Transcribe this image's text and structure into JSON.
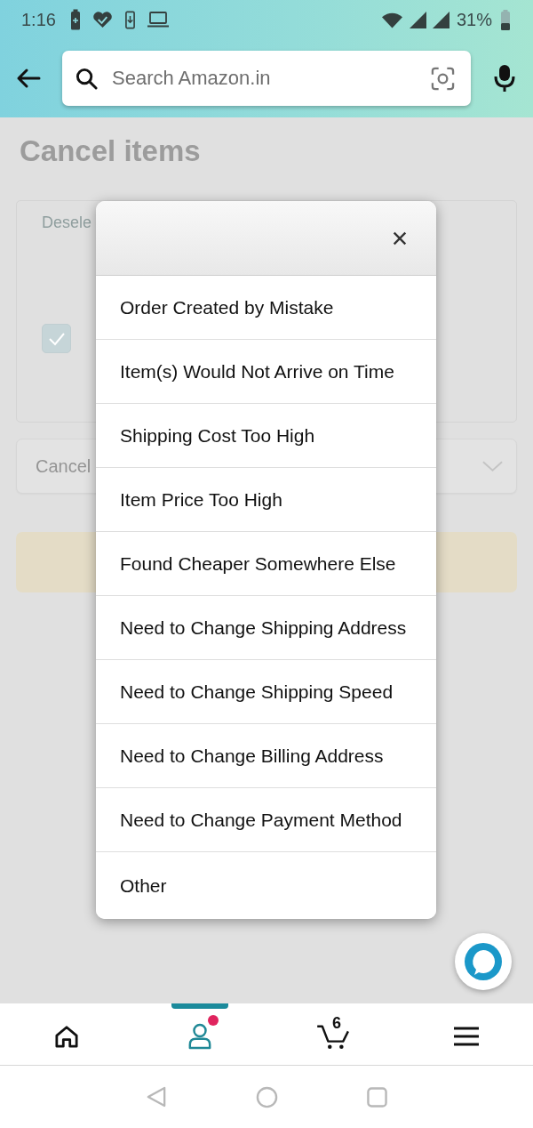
{
  "status_bar": {
    "time": "1:16",
    "battery_percent": "31%"
  },
  "header": {
    "search": {
      "placeholder": "Search Amazon.in"
    }
  },
  "page": {
    "title": "Cancel items",
    "card": {
      "text": "Desele",
      "checkbox": {
        "checked": true
      }
    },
    "dropdown": {
      "value": "Cancel"
    }
  },
  "dialog": {
    "options": [
      "Order Created by Mistake",
      "Item(s) Would Not Arrive on Time",
      "Shipping Cost Too High",
      "Item Price Too High",
      "Found Cheaper Somewhere Else",
      "Need to Change Shipping Address",
      "Need to Change Shipping Speed",
      "Need to Change Billing Address",
      "Need to Change Payment Method",
      "Other"
    ]
  },
  "bottom_nav": {
    "items": [
      {
        "kind": "home",
        "selected": false,
        "dot": false
      },
      {
        "kind": "account",
        "selected": true,
        "dot": true
      },
      {
        "kind": "cart",
        "selected": false,
        "dot": false,
        "count": "6"
      },
      {
        "kind": "menu",
        "selected": false,
        "dot": false
      }
    ]
  }
}
